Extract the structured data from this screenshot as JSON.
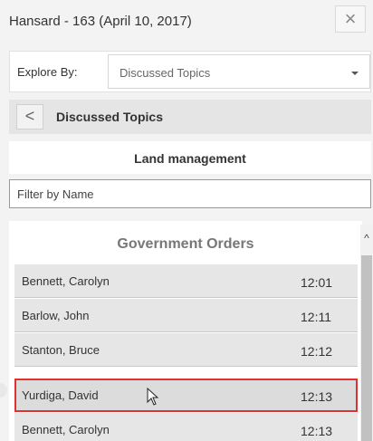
{
  "header": {
    "title": "Hansard - 163 (April 10, 2017)",
    "close_glyph": "×"
  },
  "explore": {
    "label": "Explore By:",
    "selected": "Discussed Topics"
  },
  "topics_bar": {
    "back_glyph": "<",
    "title": "Discussed Topics"
  },
  "subject": {
    "title": "Land management"
  },
  "filter": {
    "placeholder": "Filter by Name"
  },
  "list": {
    "heading": "Government Orders",
    "rows": [
      {
        "name": "Bennett, Carolyn",
        "time": "12:01"
      },
      {
        "name": "Barlow, John",
        "time": "12:11"
      },
      {
        "name": "Stanton, Bruce",
        "time": "12:12"
      },
      {
        "name": "Yurdiga, David",
        "time": "12:13"
      },
      {
        "name": "Bennett, Carolyn",
        "time": "12:13"
      }
    ]
  },
  "scrollbar": {
    "up_glyph": "^"
  },
  "colors": {
    "selected_outline": "#e03131",
    "row_background": "#e6e6e6"
  }
}
